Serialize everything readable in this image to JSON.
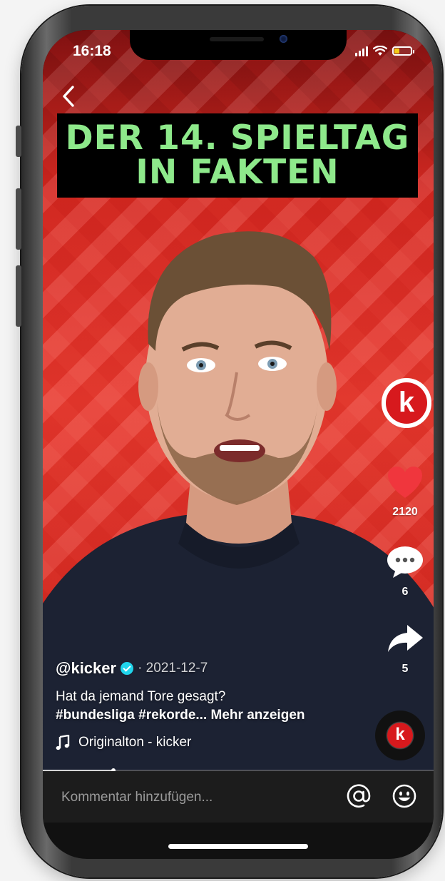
{
  "status_bar": {
    "time": "16:18"
  },
  "video": {
    "banner_lines": [
      "DER 14. SPIELTAG",
      "IN FAKTEN"
    ]
  },
  "actions": {
    "avatar_letter": "k",
    "likes": "2120",
    "comments": "6",
    "shares": "5"
  },
  "caption": {
    "author": "@kicker",
    "date": "· 2021-12-7",
    "description": "Hat da jemand Tore gesagt?",
    "tags": "#bundesliga #rekorde... Mehr anzeigen",
    "music": "Originalton - kicker"
  },
  "progress": {
    "fraction": 0.18
  },
  "comment_bar": {
    "placeholder": "Kommentar hinzufügen..."
  },
  "icons": [
    "back-icon",
    "signal-icon",
    "wifi-icon",
    "battery-icon",
    "heart-icon",
    "comment-icon",
    "share-icon",
    "music-note-icon",
    "mention-icon",
    "emoji-icon"
  ],
  "colors": {
    "accent_red": "#d7191d",
    "banner_text": "#8ee98b",
    "heart": "#f0363d"
  }
}
